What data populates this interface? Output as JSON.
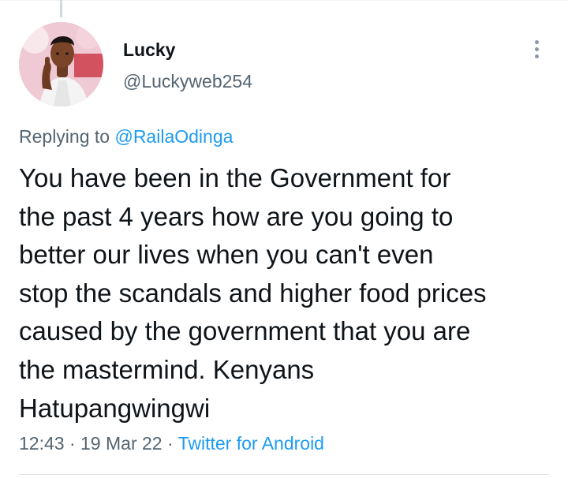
{
  "tweet": {
    "author": {
      "display_name": "Lucky",
      "handle": "@Luckyweb254",
      "avatar_icon": "profile-photo"
    },
    "reply_context": {
      "prefix": "Replying to ",
      "mention": "@RailaOdinga"
    },
    "text": "You have been in the Government for\nthe past 4 years how are you going to\nbetter our lives when you can't even\nstop the scandals and higher food prices\ncaused by the government that you are\nthe mastermind. Kenyans\nHatupangwingwi",
    "time": "12:43",
    "date": "19 Mar 22",
    "separator": " · ",
    "source": "Twitter for Android",
    "menu_icon": "more-vertical-icon"
  },
  "colors": {
    "text": "#0f1419",
    "secondary": "#536471",
    "link": "#1d9bf0",
    "divider": "#eff3f4"
  }
}
